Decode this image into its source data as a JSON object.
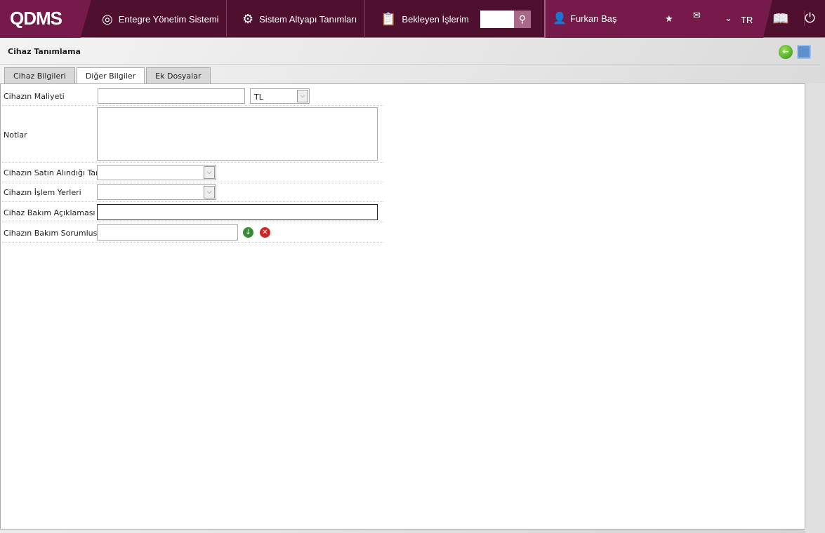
{
  "header": {
    "logo": "QDMS",
    "nav": [
      {
        "label": "Entegre Yönetim Sistemi",
        "icon": "q-icon"
      },
      {
        "label": "Sistem Altyapı Tanımları",
        "icon": "gear-icon"
      },
      {
        "label": "Bekleyen İşlerim",
        "icon": "clipboard-icon"
      }
    ],
    "search_value": "",
    "user": "Furkan Baş",
    "language": "TR"
  },
  "page": {
    "title": "Cihaz Tanımlama"
  },
  "tabs": [
    {
      "label": "Cihaz Bilgileri"
    },
    {
      "label": "Diğer Bilgiler",
      "active": true
    },
    {
      "label": "Ek Dosyalar"
    }
  ],
  "form": {
    "maliyet": {
      "label": "Cihazın Maliyeti",
      "value": "",
      "currency": "TL"
    },
    "notlar": {
      "label": "Notlar",
      "value": ""
    },
    "tarih": {
      "label": "Cihazın Satın Alındığı Tarih",
      "value": ""
    },
    "yerler": {
      "label": "Cihazın İşlem Yerleri",
      "value": ""
    },
    "aciklama": {
      "label": "Cihaz Bakım Açıklaması",
      "value": ""
    },
    "sorumlu": {
      "label": "Cihazın Bakım Sorumlusu",
      "value": ""
    }
  },
  "colors": {
    "header_dark": "#4f1030",
    "header_accent": "#751a4a"
  }
}
